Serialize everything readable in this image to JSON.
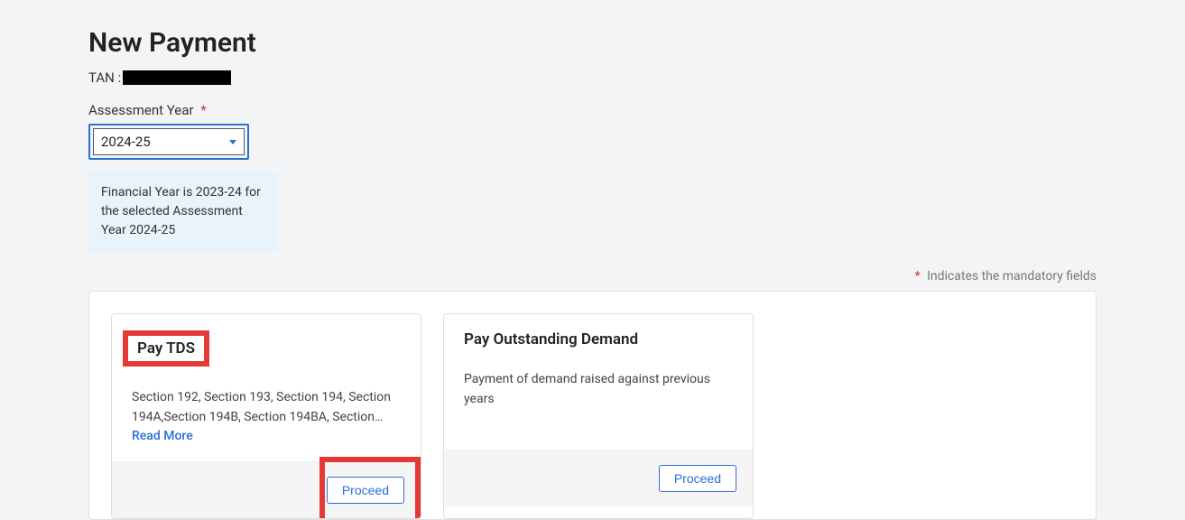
{
  "page": {
    "title": "New Payment",
    "tan_label": "TAN :",
    "tan_value": "██████████"
  },
  "assessment": {
    "label": "Assessment Year",
    "required_mark": "*",
    "selected": "2024-25",
    "info_text": "Financial Year is 2023-24 for the selected Assessment Year 2024-25"
  },
  "mandatory": {
    "star": "*",
    "text": "Indicates the mandatory fields"
  },
  "cards": {
    "pay_tds": {
      "title": "Pay TDS",
      "desc": "Section 192, Section 193, Section 194, Section 194A,Section 194B, Section 194BA, Section…",
      "read_more": "Read More",
      "proceed": "Proceed"
    },
    "outstanding": {
      "title": "Pay Outstanding Demand",
      "desc": "Payment of demand raised against previous years",
      "proceed": "Proceed"
    }
  }
}
